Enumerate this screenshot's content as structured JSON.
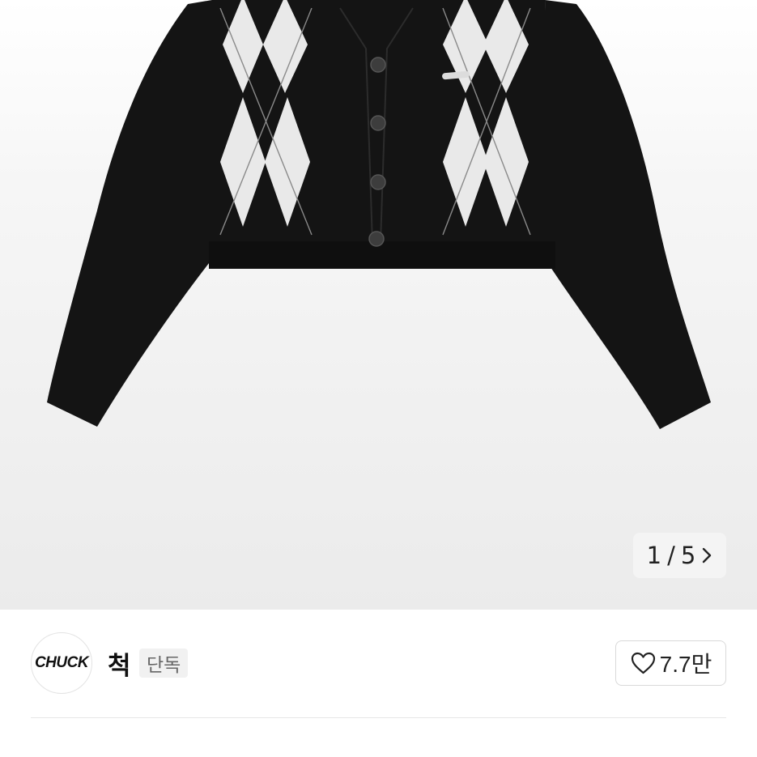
{
  "gallery": {
    "image_subject": "black argyle knit cardigan",
    "current_page": "1",
    "separator": "/",
    "total_pages": "5",
    "next_icon": "chevron-right-icon"
  },
  "store": {
    "logo_text": "CHUCK",
    "name": "척",
    "badge": "단독",
    "likes": "7.7만",
    "like_icon": "heart-outline-icon"
  },
  "colors": {
    "cardigan": "#141414",
    "argyle_light": "#e9e9e9",
    "background": "#ebebeb",
    "text": "#222222",
    "badge_text": "#666666"
  }
}
